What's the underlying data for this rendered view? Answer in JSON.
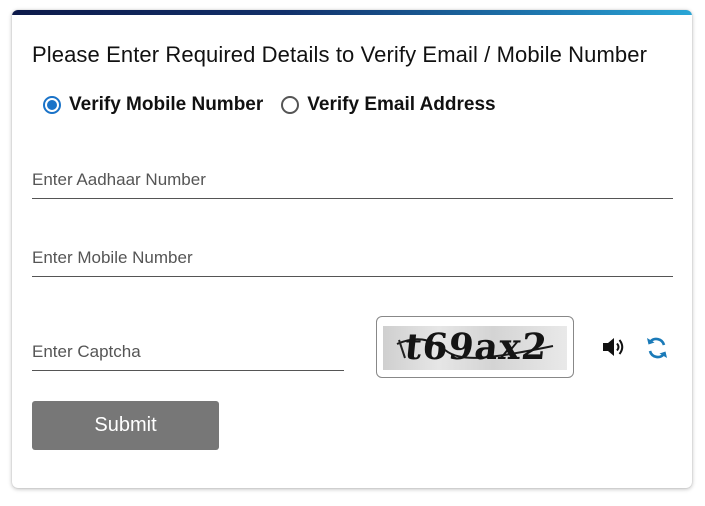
{
  "form": {
    "title": "Please Enter Required Details to Verify Email / Mobile Number",
    "radio_options": [
      {
        "label": "Verify Mobile Number",
        "checked": true
      },
      {
        "label": "Verify Email Address",
        "checked": false
      }
    ],
    "aadhaar_placeholder": "Enter Aadhaar Number",
    "mobile_placeholder": "Enter Mobile Number",
    "captcha_placeholder": "Enter Captcha",
    "captcha_text": "t69ax2",
    "submit_label": "Submit"
  },
  "icons": {
    "audio": "speaker-icon",
    "refresh": "refresh-icon"
  },
  "colors": {
    "accent": "#1a73c8",
    "refresh_icon": "#1a7ab8",
    "submit_bg": "#777777",
    "top_bar_start": "#0d1a4a",
    "top_bar_end": "#2aa6d6"
  }
}
